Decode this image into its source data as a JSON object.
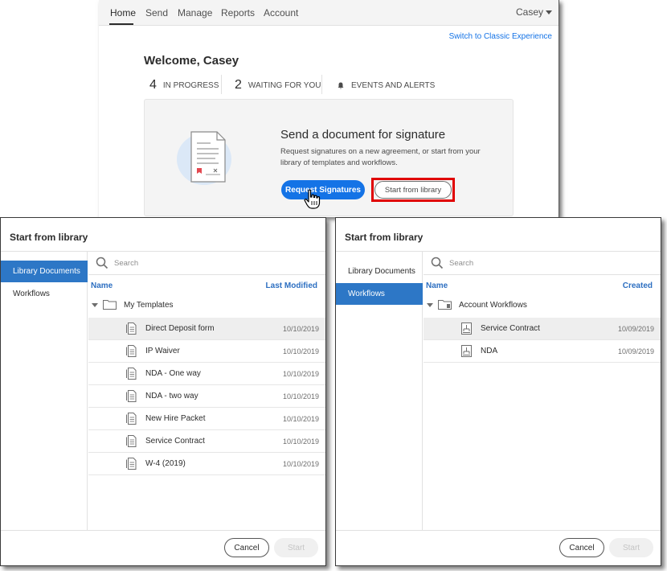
{
  "app": {
    "nav": [
      "Home",
      "Send",
      "Manage",
      "Reports",
      "Account"
    ],
    "user": "Casey",
    "classic_link": "Switch to Classic Experience",
    "welcome": "Welcome, Casey",
    "stats": [
      {
        "num": "4",
        "label": "IN PROGRESS"
      },
      {
        "num": "2",
        "label": "WAITING FOR YOU"
      },
      {
        "num": "",
        "label": "EVENTS AND ALERTS"
      }
    ],
    "send_card": {
      "title": "Send a document for signature",
      "desc": "Request signatures on a new agreement, or start from your library of templates and workflows.",
      "request_btn": "Request Signatures",
      "library_btn": "Start from library"
    },
    "colors": {
      "accent": "#1473e6",
      "highlight": "#e00000",
      "sidebar_active": "#2d77c6"
    }
  },
  "dialog_left": {
    "title": "Start from library",
    "sidebar": [
      "Library Documents",
      "Workflows"
    ],
    "active_item": "Library Documents",
    "search_placeholder": "Search",
    "col_name": "Name",
    "col_date": "Last Modified",
    "folder": "My Templates",
    "rows": [
      {
        "name": "Direct Deposit form",
        "date": "10/10/2019"
      },
      {
        "name": "IP Waiver",
        "date": "10/10/2019"
      },
      {
        "name": "NDA - One way",
        "date": "10/10/2019"
      },
      {
        "name": "NDA - two way",
        "date": "10/10/2019"
      },
      {
        "name": "New Hire Packet",
        "date": "10/10/2019"
      },
      {
        "name": "Service Contract",
        "date": "10/10/2019"
      },
      {
        "name": "W-4 (2019)",
        "date": "10/10/2019"
      }
    ],
    "cancel": "Cancel",
    "start": "Start"
  },
  "dialog_right": {
    "title": "Start from library",
    "sidebar": [
      "Library Documents",
      "Workflows"
    ],
    "active_item": "Workflows",
    "search_placeholder": "Search",
    "col_name": "Name",
    "col_date": "Created",
    "folder": "Account Workflows",
    "rows": [
      {
        "name": "Service Contract",
        "date": "10/09/2019"
      },
      {
        "name": "NDA",
        "date": "10/09/2019"
      }
    ],
    "cancel": "Cancel",
    "start": "Start"
  }
}
